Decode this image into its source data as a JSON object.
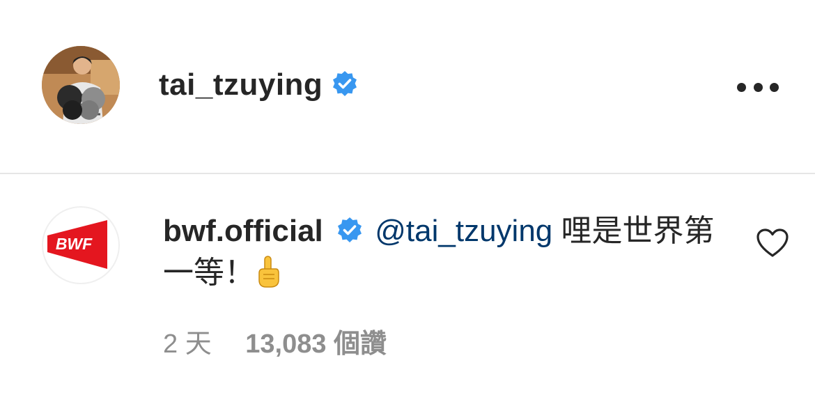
{
  "post_header": {
    "username": "tai_tzuying",
    "verified": true,
    "more_icon": "more-horizontal-icon"
  },
  "comment": {
    "username": "bwf.official",
    "verified": true,
    "mention": "@tai_tzuying",
    "text": " 哩是世界第一等！",
    "emoji": "☝️",
    "time": "2 天",
    "likes": "13,083 個讚",
    "like_icon": "heart-outline-icon",
    "avatar_logo_text": "BWF"
  },
  "colors": {
    "verified_blue": "#3897f0",
    "mention_blue": "#00376b",
    "meta_gray": "#8e8e8e",
    "bwf_red": "#e4161f"
  }
}
